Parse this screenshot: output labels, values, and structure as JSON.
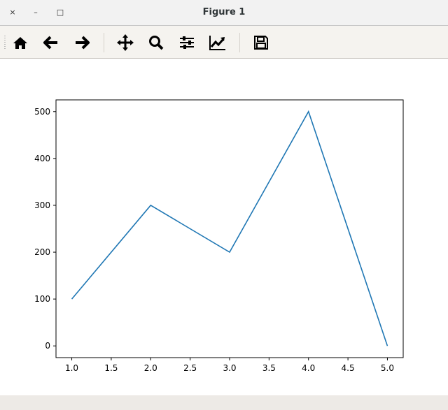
{
  "window": {
    "title": "Figure 1",
    "close_icon": "×",
    "minimize_icon": "–",
    "maximize_icon": "□"
  },
  "toolbar": {
    "items": [
      "home-icon",
      "back-icon",
      "forward-icon",
      "pan-icon",
      "zoom-icon",
      "configure-subplots-icon",
      "edit-axes-icon",
      "save-icon"
    ]
  },
  "colors": {
    "line": "#1f77b4"
  },
  "chart_data": {
    "type": "line",
    "title": "",
    "xlabel": "",
    "ylabel": "",
    "x": [
      1,
      2,
      3,
      4,
      5
    ],
    "series": [
      {
        "name": "",
        "values": [
          100,
          300,
          200,
          500,
          0
        ]
      }
    ],
    "xlim": [
      0.8,
      5.2
    ],
    "ylim": [
      -25,
      525
    ],
    "xticks": [
      "1.0",
      "1.5",
      "2.0",
      "2.5",
      "3.0",
      "3.5",
      "4.0",
      "4.5",
      "5.0"
    ],
    "yticks": [
      "0",
      "100",
      "200",
      "300",
      "400",
      "500"
    ],
    "grid": false
  }
}
